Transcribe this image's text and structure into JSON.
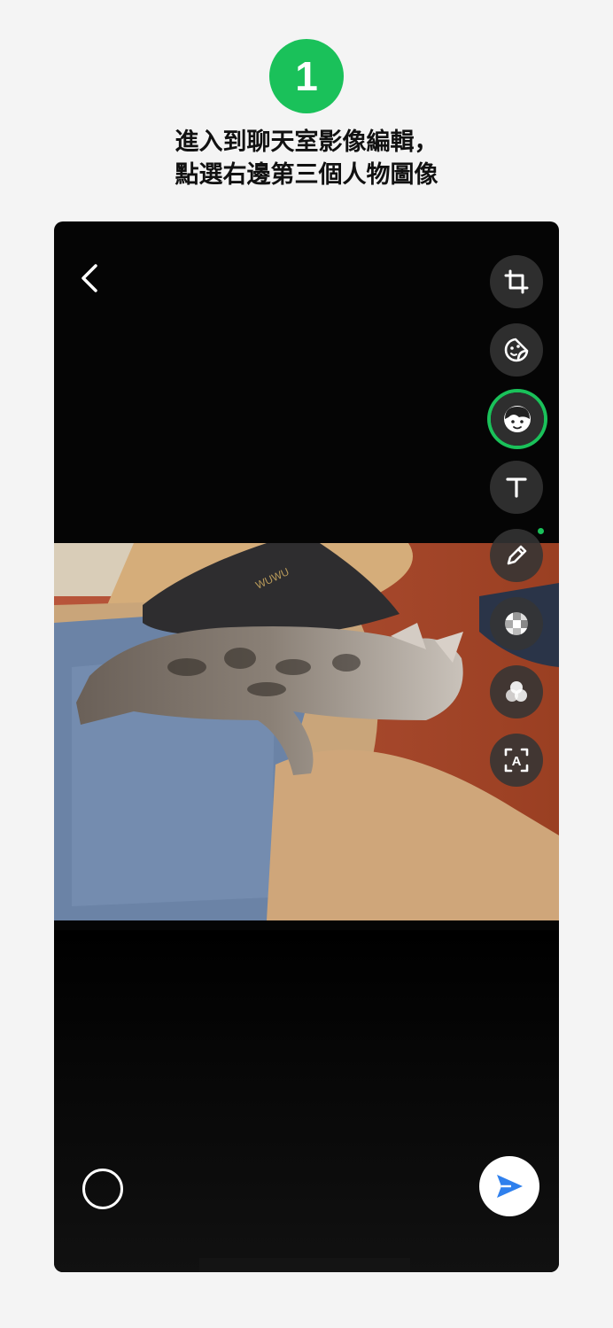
{
  "step": {
    "number": "1",
    "color": "#1ac15a"
  },
  "instruction": {
    "line1": "進入到聊天室影像編輯，",
    "line2": "點選右邊第三個人物圖像"
  },
  "editor": {
    "back_icon": "chevron-left-icon",
    "tools": [
      {
        "name": "crop",
        "icon": "crop-icon"
      },
      {
        "name": "sticker",
        "icon": "sticker-icon"
      },
      {
        "name": "face-sticker",
        "icon": "face-icon",
        "highlighted": true
      },
      {
        "name": "text",
        "icon": "text-icon"
      },
      {
        "name": "draw",
        "icon": "pencil-icon"
      },
      {
        "name": "mosaic",
        "icon": "mosaic-icon"
      },
      {
        "name": "filter",
        "icon": "filter-icon"
      },
      {
        "name": "text-recognition",
        "icon": "scan-text-icon"
      }
    ],
    "scan_text_glyph": "A",
    "photo_logo": "WUWU",
    "send_color": "#2f80ed"
  }
}
